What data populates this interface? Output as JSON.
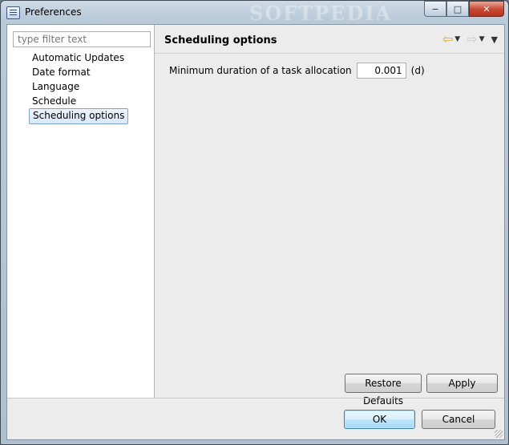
{
  "window": {
    "title": "Preferences",
    "watermark": "SOFTPEDIA",
    "controls": {
      "minimize": "−",
      "maximize": "□",
      "close": "✕"
    }
  },
  "filter": {
    "placeholder": "type filter text",
    "value": ""
  },
  "tree": {
    "items": [
      {
        "label": "Automatic Updates",
        "selected": false
      },
      {
        "label": "Date format",
        "selected": false
      },
      {
        "label": "Language",
        "selected": false
      },
      {
        "label": "Schedule",
        "selected": false
      },
      {
        "label": "Scheduling options",
        "selected": true
      }
    ]
  },
  "page": {
    "title": "Scheduling options",
    "nav": {
      "back_icon": "back-arrow-icon",
      "forward_icon": "forward-arrow-icon",
      "menu_icon": "view-menu-icon"
    },
    "fields": {
      "min_duration": {
        "label": "Minimum duration of a task allocation",
        "value": "0.001",
        "unit": "(d)"
      }
    },
    "restore_defaults_label": "Restore Defaults",
    "apply_label": "Apply"
  },
  "dialog": {
    "ok_label": "OK",
    "cancel_label": "Cancel"
  },
  "colors": {
    "selection_border": "#7da2ce",
    "primary_button": "#3c7fb1",
    "back_arrow": "#e0a030"
  }
}
